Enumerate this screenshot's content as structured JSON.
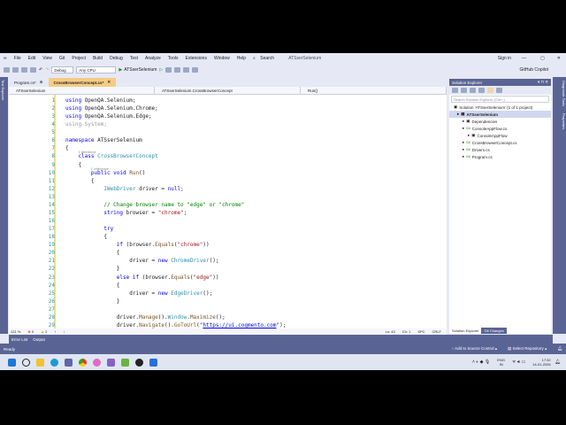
{
  "title": "ATSserSelenium",
  "menu": [
    "File",
    "Edit",
    "View",
    "Git",
    "Project",
    "Build",
    "Debug",
    "Test",
    "Analyze",
    "Tools",
    "Extensions",
    "Window",
    "Help"
  ],
  "search": "Search",
  "sign_in": "Sign in",
  "copilot": "GitHub Copilot",
  "toolbar": {
    "config": "Debug",
    "platform": "Any CPU",
    "run": "ATSserSelenium"
  },
  "tabs": [
    {
      "label": "Program.cs*"
    },
    {
      "label": "CrossBrowserConcept.cs*"
    }
  ],
  "navbar": {
    "project": "ATSserSelenium",
    "class": "ATSserSelenium.CrossBrowserConcept",
    "member": "Run()"
  },
  "left_rail": "Test Explorer",
  "code": [
    {
      "n": "1",
      "t": [
        [
          "using ",
          "kw"
        ],
        [
          "OpenQA.Selenium;",
          ""
        ]
      ]
    },
    {
      "n": "2",
      "t": [
        [
          "using ",
          "kw"
        ],
        [
          "OpenQA.Selenium.Chrome;",
          ""
        ]
      ]
    },
    {
      "n": "3",
      "t": [
        [
          "using ",
          "kw"
        ],
        [
          "OpenQA.Selenium.Edge;",
          ""
        ]
      ]
    },
    {
      "n": "4",
      "t": [
        [
          "using System;",
          "dim"
        ]
      ]
    },
    {
      "n": "5",
      "t": []
    },
    {
      "n": "6",
      "t": [
        [
          "namespace ",
          "kw"
        ],
        [
          "ATSserSelenium",
          ""
        ]
      ]
    },
    {
      "n": "7",
      "t": [
        [
          "{",
          ""
        ]
      ]
    },
    {
      "n": "8",
      "ref": "1 reference",
      "t": [
        [
          "    class ",
          "kw"
        ],
        [
          "CrossBrowserConcept",
          "ty"
        ]
      ]
    },
    {
      "n": "9",
      "t": [
        [
          "    {",
          ""
        ]
      ]
    },
    {
      "n": "10",
      "ref": "1 reference",
      "t": [
        [
          "        public void ",
          "kw"
        ],
        [
          "Run",
          "mt"
        ],
        [
          "()",
          ""
        ]
      ]
    },
    {
      "n": "11",
      "t": [
        [
          "        {",
          ""
        ]
      ]
    },
    {
      "n": "12",
      "t": [
        [
          "            ",
          ""
        ],
        [
          "IWebDriver",
          "ty"
        ],
        [
          " driver = ",
          ""
        ],
        [
          "null",
          "kw"
        ],
        [
          ";",
          ""
        ]
      ]
    },
    {
      "n": "13",
      "t": []
    },
    {
      "n": "14",
      "t": [
        [
          "            // Change browser name to \"edge\" or \"chrome\"",
          "cm"
        ]
      ]
    },
    {
      "n": "15",
      "t": [
        [
          "            string ",
          "kw"
        ],
        [
          "browser = ",
          ""
        ],
        [
          "\"chrome\"",
          "st"
        ],
        [
          ";",
          ""
        ]
      ]
    },
    {
      "n": "16",
      "t": []
    },
    {
      "n": "17",
      "t": [
        [
          "            try",
          "kw"
        ]
      ]
    },
    {
      "n": "18",
      "t": [
        [
          "            {",
          ""
        ]
      ]
    },
    {
      "n": "19",
      "t": [
        [
          "                if ",
          "kw"
        ],
        [
          "(browser.",
          ""
        ],
        [
          "Equals",
          "mt"
        ],
        [
          "(",
          ""
        ],
        [
          "\"chrome\"",
          "st"
        ],
        [
          "))",
          ""
        ]
      ]
    },
    {
      "n": "20",
      "t": [
        [
          "                {",
          ""
        ]
      ]
    },
    {
      "n": "21",
      "t": [
        [
          "                    driver = ",
          ""
        ],
        [
          "new ",
          "kw"
        ],
        [
          "ChromeDriver",
          "ty"
        ],
        [
          "();",
          ""
        ]
      ]
    },
    {
      "n": "22",
      "t": [
        [
          "                }",
          ""
        ]
      ]
    },
    {
      "n": "23",
      "t": [
        [
          "                else if ",
          "kw"
        ],
        [
          "(browser.",
          ""
        ],
        [
          "Equals",
          "mt"
        ],
        [
          "(",
          ""
        ],
        [
          "\"edge\"",
          "st"
        ],
        [
          "))",
          ""
        ]
      ]
    },
    {
      "n": "24",
      "t": [
        [
          "                {",
          ""
        ]
      ]
    },
    {
      "n": "25",
      "t": [
        [
          "                    driver = ",
          ""
        ],
        [
          "new ",
          "kw"
        ],
        [
          "EdgeDriver",
          "ty"
        ],
        [
          "();",
          ""
        ]
      ]
    },
    {
      "n": "26",
      "t": [
        [
          "                }",
          ""
        ]
      ]
    },
    {
      "n": "27",
      "t": []
    },
    {
      "n": "28",
      "t": [
        [
          "                driver.",
          ""
        ],
        [
          "Manage",
          "mt"
        ],
        [
          "().",
          ""
        ],
        [
          "Window",
          "ty"
        ],
        [
          ".",
          ""
        ],
        [
          "Maximize",
          "mt"
        ],
        [
          "();",
          ""
        ]
      ]
    },
    {
      "n": "29",
      "t": [
        [
          "                driver.",
          ""
        ],
        [
          "Navigate",
          "mt"
        ],
        [
          "().",
          ""
        ],
        [
          "GoToUrl",
          "mt"
        ],
        [
          "(\"",
          ""
        ],
        [
          "https://ui.cogmento.com",
          "ul"
        ],
        [
          "\");",
          ""
        ]
      ]
    }
  ],
  "editor_status": {
    "zoom": "121 %",
    "errors": "0",
    "warnings": "2",
    "line": "Ln: 43",
    "col": "Ch: 1",
    "spc": "SPC",
    "eol": "CRLF"
  },
  "solution": {
    "title": "Solution Explorer",
    "search": "Search Solution Explorer (Ctrl+;)",
    "items": [
      {
        "label": "Solution 'ATSserSelenium' (1 of 1 project)",
        "lvl": 0
      },
      {
        "label": "ATSserSelenium",
        "lvl": 1,
        "sel": true
      },
      {
        "label": "Dependencies",
        "lvl": 2
      },
      {
        "label": "ConsoleAppFlow.cs",
        "lvl": 2,
        "cs": true
      },
      {
        "label": "ConsoleAppFlow",
        "lvl": 3
      },
      {
        "label": "CrossBrowserConcept.cs",
        "lvl": 2,
        "cs": true
      },
      {
        "label": "Drivers.cs",
        "lvl": 2,
        "cs": true
      },
      {
        "label": "Program.cs",
        "lvl": 2,
        "cs": true
      }
    ],
    "tabs": [
      "Solution Explorer",
      "Git Changes"
    ]
  },
  "right_rail": [
    "Diagnostic Tools",
    "Properties"
  ],
  "bottom_tabs": [
    "Error List",
    "Output"
  ],
  "status": {
    "ready": "Ready",
    "source_control": "Add to Source Control",
    "repo": "Select Repository"
  },
  "tray": {
    "lang1": "ENG",
    "lang2": "IN",
    "time": "17:32",
    "date": "14-01-2026"
  }
}
